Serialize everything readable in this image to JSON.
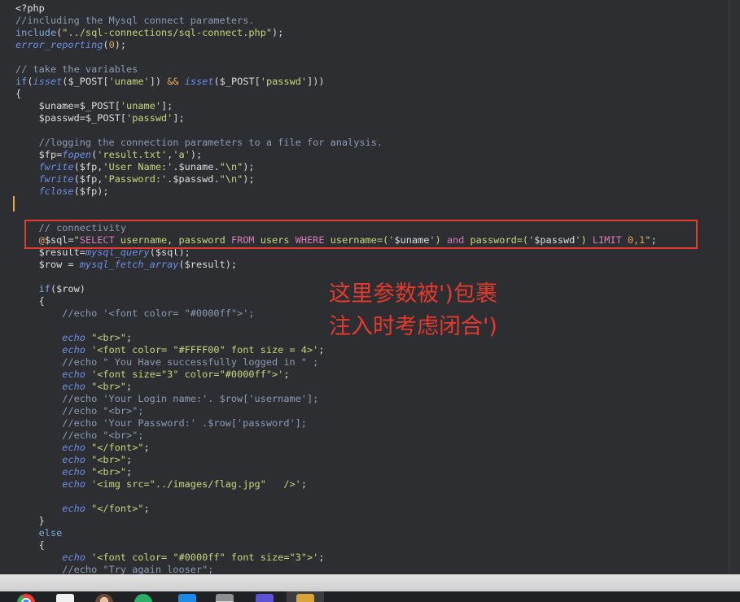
{
  "editor": {
    "background": "#2c2e31",
    "active_line_marker_color": "#f0a232",
    "syntax_colors": {
      "tag": "#e6e6e6",
      "com": "#8c9cb4",
      "kw": "#82a9e0",
      "fn": "#6f8ee6",
      "str": "#c6d77f",
      "num": "#e3a35e",
      "var": "#dedede",
      "op": "#e3a35e",
      "p": "#d8d8d8",
      "sqlkw": "#d67ab9"
    },
    "lines": [
      [
        {
          "tag": "<?php"
        }
      ],
      [
        {
          "com": "//including the Mysql connect parameters."
        }
      ],
      [
        {
          "kw": "include"
        },
        {
          "p": "("
        },
        {
          "str": "\"../sql-connections/sql-connect.php\""
        },
        {
          "p": ");"
        }
      ],
      [
        {
          "fn": "error_reporting"
        },
        {
          "p": "("
        },
        {
          "num": "0"
        },
        {
          "p": ");"
        }
      ],
      [],
      [
        {
          "com": "// take the variables"
        }
      ],
      [
        {
          "kw": "if"
        },
        {
          "p": "("
        },
        {
          "fn": "isset"
        },
        {
          "p": "("
        },
        {
          "var": "$_POST"
        },
        {
          "p": "["
        },
        {
          "str": "'uname'"
        },
        {
          "p": "]) "
        },
        {
          "op": "&&"
        },
        {
          "p": " "
        },
        {
          "fn": "isset"
        },
        {
          "p": "("
        },
        {
          "var": "$_POST"
        },
        {
          "p": "["
        },
        {
          "str": "'passwd'"
        },
        {
          "p": "]))"
        }
      ],
      [
        {
          "p": "{"
        }
      ],
      [
        {
          "p": "    "
        },
        {
          "var": "$uname"
        },
        {
          "p": "="
        },
        {
          "var": "$_POST"
        },
        {
          "p": "["
        },
        {
          "str": "'uname'"
        },
        {
          "p": "];"
        }
      ],
      [
        {
          "p": "    "
        },
        {
          "var": "$passwd"
        },
        {
          "p": "="
        },
        {
          "var": "$_POST"
        },
        {
          "p": "["
        },
        {
          "str": "'passwd'"
        },
        {
          "p": "];"
        }
      ],
      [],
      [
        {
          "p": "    "
        },
        {
          "com": "//logging the connection parameters to a file for analysis."
        }
      ],
      [
        {
          "p": "    "
        },
        {
          "var": "$fp"
        },
        {
          "p": "="
        },
        {
          "fn": "fopen"
        },
        {
          "p": "("
        },
        {
          "str": "'result.txt'"
        },
        {
          "p": ","
        },
        {
          "str": "'a'"
        },
        {
          "p": ");"
        }
      ],
      [
        {
          "p": "    "
        },
        {
          "fn": "fwrite"
        },
        {
          "p": "("
        },
        {
          "var": "$fp"
        },
        {
          "p": ","
        },
        {
          "str": "'User Name:'"
        },
        {
          "p": "."
        },
        {
          "var": "$uname"
        },
        {
          "p": "."
        },
        {
          "str": "\"\\n\""
        },
        {
          "p": ");"
        }
      ],
      [
        {
          "p": "    "
        },
        {
          "fn": "fwrite"
        },
        {
          "p": "("
        },
        {
          "var": "$fp"
        },
        {
          "p": ","
        },
        {
          "str": "'Password:'"
        },
        {
          "p": "."
        },
        {
          "var": "$passwd"
        },
        {
          "p": "."
        },
        {
          "str": "\"\\n\""
        },
        {
          "p": ");"
        }
      ],
      [
        {
          "p": "    "
        },
        {
          "fn": "fclose"
        },
        {
          "p": "("
        },
        {
          "var": "$fp"
        },
        {
          "p": ");"
        }
      ],
      [],
      [],
      [
        {
          "p": "    "
        },
        {
          "com": "// connectivity"
        }
      ],
      [
        {
          "p": "    "
        },
        {
          "op": "@"
        },
        {
          "var": "$sql"
        },
        {
          "p": "="
        },
        {
          "str": "\""
        },
        {
          "sqlkw": "SELECT"
        },
        {
          "str": " username, password "
        },
        {
          "sqlkw": "FROM"
        },
        {
          "str": " users "
        },
        {
          "sqlkw": "WHERE"
        },
        {
          "str": " username=('"
        },
        {
          "var": "$uname"
        },
        {
          "str": "') "
        },
        {
          "sqlkw": "and"
        },
        {
          "str": " password=('"
        },
        {
          "var": "$passwd"
        },
        {
          "str": "') "
        },
        {
          "sqlkw": "LIMIT"
        },
        {
          "str": " "
        },
        {
          "num": "0,1"
        },
        {
          "str": "\""
        },
        {
          "p": ";"
        }
      ],
      [
        {
          "p": "    "
        },
        {
          "var": "$result"
        },
        {
          "p": "="
        },
        {
          "fn": "mysql_query"
        },
        {
          "p": "("
        },
        {
          "var": "$sql"
        },
        {
          "p": ");"
        }
      ],
      [
        {
          "p": "    "
        },
        {
          "var": "$row"
        },
        {
          "p": " = "
        },
        {
          "fn": "mysql_fetch_array"
        },
        {
          "p": "("
        },
        {
          "var": "$result"
        },
        {
          "p": ");"
        }
      ],
      [],
      [
        {
          "p": "    "
        },
        {
          "kw": "if"
        },
        {
          "p": "("
        },
        {
          "var": "$row"
        },
        {
          "p": ")"
        }
      ],
      [
        {
          "p": "    {"
        }
      ],
      [
        {
          "p": "        "
        },
        {
          "com": "//echo '<font color= \"#0000ff\">';"
        }
      ],
      [],
      [
        {
          "p": "        "
        },
        {
          "fn": "echo"
        },
        {
          "p": " "
        },
        {
          "str": "\"<br>\""
        },
        {
          "p": ";"
        }
      ],
      [
        {
          "p": "        "
        },
        {
          "fn": "echo"
        },
        {
          "p": " "
        },
        {
          "str": "'<font color= \"#FFFF00\" font size = 4>'"
        },
        {
          "p": ";"
        }
      ],
      [
        {
          "p": "        "
        },
        {
          "com": "//echo \" You Have successfully logged in \" ;"
        }
      ],
      [
        {
          "p": "        "
        },
        {
          "fn": "echo"
        },
        {
          "p": " "
        },
        {
          "str": "'<font size=\"3\" color=\"#0000ff\">'"
        },
        {
          "p": ";"
        }
      ],
      [
        {
          "p": "        "
        },
        {
          "fn": "echo"
        },
        {
          "p": " "
        },
        {
          "str": "\"<br>\""
        },
        {
          "p": ";"
        }
      ],
      [
        {
          "p": "        "
        },
        {
          "com": "//echo 'Your Login name:'. $row['username'];"
        }
      ],
      [
        {
          "p": "        "
        },
        {
          "com": "//echo \"<br>\";"
        }
      ],
      [
        {
          "p": "        "
        },
        {
          "com": "//echo 'Your Password:' .$row['password'];"
        }
      ],
      [
        {
          "p": "        "
        },
        {
          "com": "//echo \"<br>\";"
        }
      ],
      [
        {
          "p": "        "
        },
        {
          "fn": "echo"
        },
        {
          "p": " "
        },
        {
          "str": "\"</font>\""
        },
        {
          "p": ";"
        }
      ],
      [
        {
          "p": "        "
        },
        {
          "fn": "echo"
        },
        {
          "p": " "
        },
        {
          "str": "\"<br>\""
        },
        {
          "p": ";"
        }
      ],
      [
        {
          "p": "        "
        },
        {
          "fn": "echo"
        },
        {
          "p": " "
        },
        {
          "str": "\"<br>\""
        },
        {
          "p": ";"
        }
      ],
      [
        {
          "p": "        "
        },
        {
          "fn": "echo"
        },
        {
          "p": " "
        },
        {
          "str": "'<img src=\"../images/flag.jpg\"   />'"
        },
        {
          "p": ";"
        }
      ],
      [],
      [
        {
          "p": "        "
        },
        {
          "fn": "echo"
        },
        {
          "p": " "
        },
        {
          "str": "\"</font>\""
        },
        {
          "p": ";"
        }
      ],
      [
        {
          "p": "    }"
        }
      ],
      [
        {
          "p": "    "
        },
        {
          "kw": "else"
        }
      ],
      [
        {
          "p": "    {"
        }
      ],
      [
        {
          "p": "        "
        },
        {
          "fn": "echo"
        },
        {
          "p": " "
        },
        {
          "str": "'<font color= \"#0000ff\" font size=\"3\">'"
        },
        {
          "p": ";"
        }
      ],
      [
        {
          "p": "        "
        },
        {
          "com": "//echo \"Try again looser\";"
        }
      ]
    ]
  },
  "annotation": {
    "color": "#e5392e",
    "lines": [
      "这里参数被')包裹",
      "注入时考虑闭合')"
    ]
  },
  "taskbar": {
    "icons": [
      {
        "icon": "chrome-icon",
        "color": "#fbbc05"
      },
      {
        "icon": "white-app-icon",
        "color": "#f1f1f1"
      },
      {
        "icon": "user-avatar-icon",
        "color": "#6b4a3a"
      },
      {
        "icon": "wechat-icon",
        "color": "#2aae67"
      },
      {
        "icon": "blue-app-icon",
        "color": "#1e88e5"
      },
      {
        "icon": "gray-app-icon",
        "color": "#b0b0b0"
      },
      {
        "icon": "purple-app-icon",
        "color": "#5b52d6"
      },
      {
        "icon": "folder-icon",
        "color": "#d8a43a"
      }
    ]
  }
}
